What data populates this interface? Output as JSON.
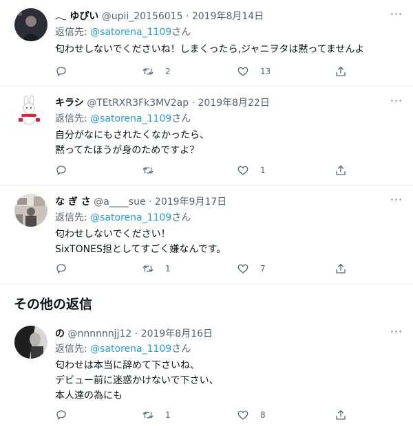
{
  "tweets": [
    {
      "name": "𓂃 ゆぴい",
      "handle": "@upii_20156015",
      "dot": "·",
      "date": "2019年8月14日",
      "reply_prefix": "返信先: ",
      "reply_to": "@satorena_1109",
      "reply_suffix": "さん",
      "lines": [
        "匂わせしないでくださいね！しまくったら,ジャニヲタは黙ってませんよ"
      ],
      "retweets": "2",
      "likes": "13"
    },
    {
      "name": "キラシ",
      "handle": "@TEtRXR3Fk3MV2ap",
      "dot": "·",
      "date": "2019年8月22日",
      "reply_prefix": "返信先: ",
      "reply_to": "@satorena_1109",
      "reply_suffix": "さん",
      "lines": [
        "自分がなにもされたくなかったら、",
        "黙ってたほうが身のためですよ？"
      ],
      "retweets": "",
      "likes": "1"
    },
    {
      "name": "な ぎ さ",
      "handle": "@a____sue",
      "dot": "·",
      "date": "2019年9月17日",
      "reply_prefix": "返信先: ",
      "reply_to": "@satorena_1109",
      "reply_suffix": "さん",
      "lines": [
        "匂わせしないでください！",
        "SixTONES担としてすごく嫌なんです。"
      ],
      "retweets": "1",
      "likes": "7"
    },
    {
      "name": "の",
      "handle": "@nnnnnnjj12",
      "dot": "·",
      "date": "2019年8月16日",
      "reply_prefix": "返信先: ",
      "reply_to": "@satorena_1109",
      "reply_suffix": "さん",
      "lines": [
        "匂わせは本当に辞めて下さいね、",
        "デビュー前に迷惑かけないで下さい、",
        "本人達の為にも"
      ],
      "retweets": "1",
      "likes": "8"
    }
  ],
  "section": {
    "title": "その他の返信"
  },
  "colors": {
    "accent": "#1d9bf0",
    "text": "#0f1419",
    "muted": "#536471",
    "divider": "#eff3f4"
  },
  "icons": [
    "reply-icon",
    "retweet-icon",
    "like-icon",
    "share-icon",
    "more-icon"
  ]
}
